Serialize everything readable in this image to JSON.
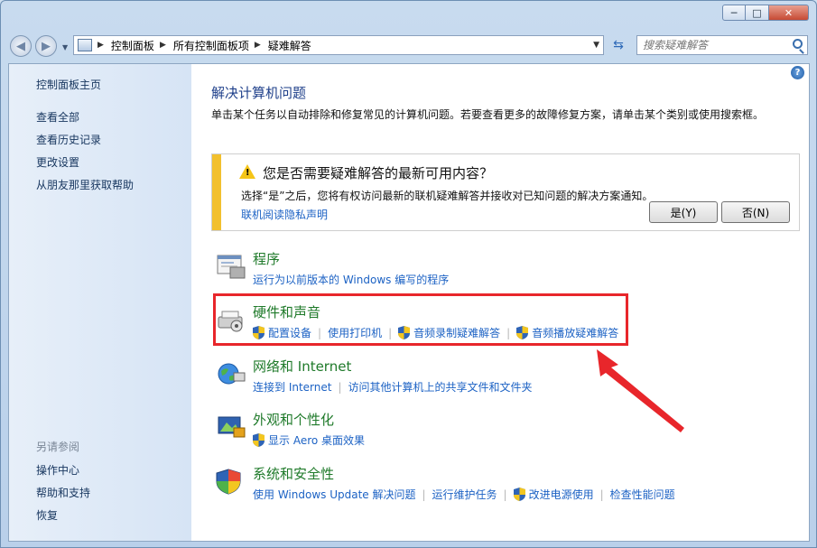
{
  "window": {
    "caption_buttons": {
      "min": "─",
      "max": "□",
      "close": "✕"
    }
  },
  "nav": {
    "back_icon": "back-arrow-icon",
    "forward_icon": "forward-arrow-icon",
    "breadcrumb": [
      "控制面板",
      "所有控制面板项",
      "疑难解答"
    ],
    "search_placeholder": "搜索疑难解答"
  },
  "sidebar": {
    "items": [
      "控制面板主页",
      "查看全部",
      "查看历史记录",
      "更改设置",
      "从朋友那里获取帮助"
    ],
    "see_also_label": "另请参阅",
    "see_also": [
      "操作中心",
      "帮助和支持",
      "恢复"
    ]
  },
  "main": {
    "help_glyph": "?",
    "title": "解决计算机问题",
    "description": "单击某个任务以自动排除和修复常见的计算机问题。若要查看更多的故障修复方案，请单击某个类别或使用搜索框。",
    "banner": {
      "title": "您是否需要疑难解答的最新可用内容？",
      "text": "选择“是”之后，您将有权访问最新的联机疑难解答并接收对已知问题的解决方案通知。",
      "link": "联机阅读隐私声明",
      "yes_button": "是(Y)",
      "no_button": "否(N)",
      "stripe_color": "#f2c02e"
    },
    "categories": [
      {
        "title": "程序",
        "tasks": [
          {
            "label": "运行为以前版本的 Windows 编写的程序",
            "shield": false
          }
        ]
      },
      {
        "title": "硬件和声音",
        "tasks": [
          {
            "label": "配置设备",
            "shield": true
          },
          {
            "label": "使用打印机",
            "shield": false
          },
          {
            "label": "音频录制疑难解答",
            "shield": true
          },
          {
            "label": "音频播放疑难解答",
            "shield": true
          }
        ]
      },
      {
        "title": "网络和 Internet",
        "tasks": [
          {
            "label": "连接到 Internet",
            "shield": false
          },
          {
            "label": "访问其他计算机上的共享文件和文件夹",
            "shield": false
          }
        ]
      },
      {
        "title": "外观和个性化",
        "tasks": [
          {
            "label": "显示 Aero 桌面效果",
            "shield": true
          }
        ]
      },
      {
        "title": "系统和安全性",
        "tasks": [
          {
            "label": "使用 Windows Update 解决问题",
            "shield": false
          },
          {
            "label": "运行维护任务",
            "shield": false
          },
          {
            "label": "改进电源使用",
            "shield": true
          },
          {
            "label": "检查性能问题",
            "shield": false
          }
        ]
      }
    ]
  },
  "annotation": {
    "highlight_color": "#e8262b"
  }
}
